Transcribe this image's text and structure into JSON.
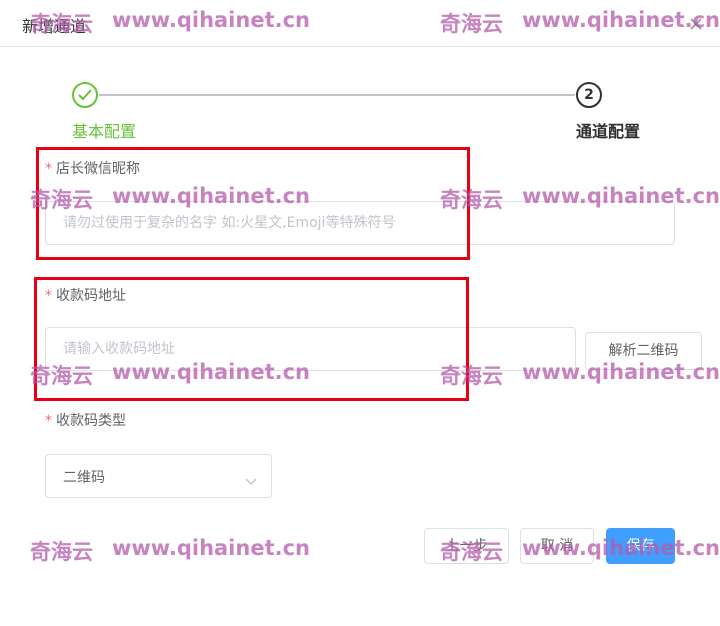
{
  "dialog": {
    "title": "新增通道"
  },
  "steps": [
    {
      "label": "基本配置",
      "status": "done"
    },
    {
      "label": "通道配置",
      "number": "2",
      "status": "current"
    }
  ],
  "form": {
    "nickname": {
      "label": "店长微信昵称",
      "required_mark": "*",
      "value": "",
      "placeholder": "请勿过使用于复杂的名字 如:火星文,Emoji等特殊符号"
    },
    "qrcode_url": {
      "label": "收款码地址",
      "required_mark": "*",
      "value": "",
      "placeholder": "请输入收款码地址",
      "parse_button": "解析二维码"
    },
    "qrcode_type": {
      "label": "收款码类型",
      "required_mark": "*",
      "selected": "二维码"
    }
  },
  "footer": {
    "prev_label": "上一步",
    "cancel_label": "取 消",
    "save_label": "保存"
  },
  "watermark": {
    "brand": "奇海云",
    "url": "www.qihainet.cn",
    "color": "#b45aaa"
  },
  "colors": {
    "success": "#67c23a",
    "primary": "#409eff",
    "required": "#f56c6c",
    "highlight_box": "#e60012"
  }
}
